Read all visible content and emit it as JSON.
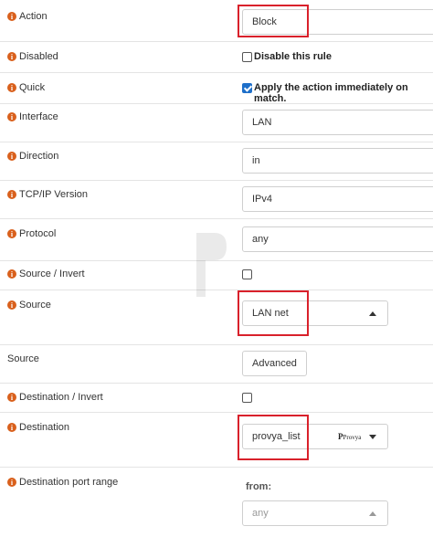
{
  "rows": {
    "action": {
      "label": "Action",
      "value": "Block"
    },
    "disabled": {
      "label": "Disabled",
      "checkbox_label": "Disable this rule"
    },
    "quick": {
      "label": "Quick",
      "checkbox_label": "Apply the action immediately on match."
    },
    "interface": {
      "label": "Interface",
      "value": "LAN"
    },
    "direction": {
      "label": "Direction",
      "value": "in"
    },
    "tcpip": {
      "label": "TCP/IP Version",
      "value": "IPv4"
    },
    "protocol": {
      "label": "Protocol",
      "value": "any"
    },
    "source_invert": {
      "label": "Source / Invert"
    },
    "source": {
      "label": "Source",
      "value": "LAN net"
    },
    "source_adv": {
      "label": "Source",
      "button": "Advanced"
    },
    "dest_invert": {
      "label": "Destination / Invert"
    },
    "destination": {
      "label": "Destination",
      "value": "provya_list",
      "logo_text": "Provya"
    },
    "dest_port": {
      "label": "Destination port range",
      "from_label": "from:",
      "from_value": "any"
    }
  },
  "colors": {
    "info_icon": "#d9601c",
    "highlight": "#d9212b",
    "checkbox_checked": "#1e6fc9"
  }
}
